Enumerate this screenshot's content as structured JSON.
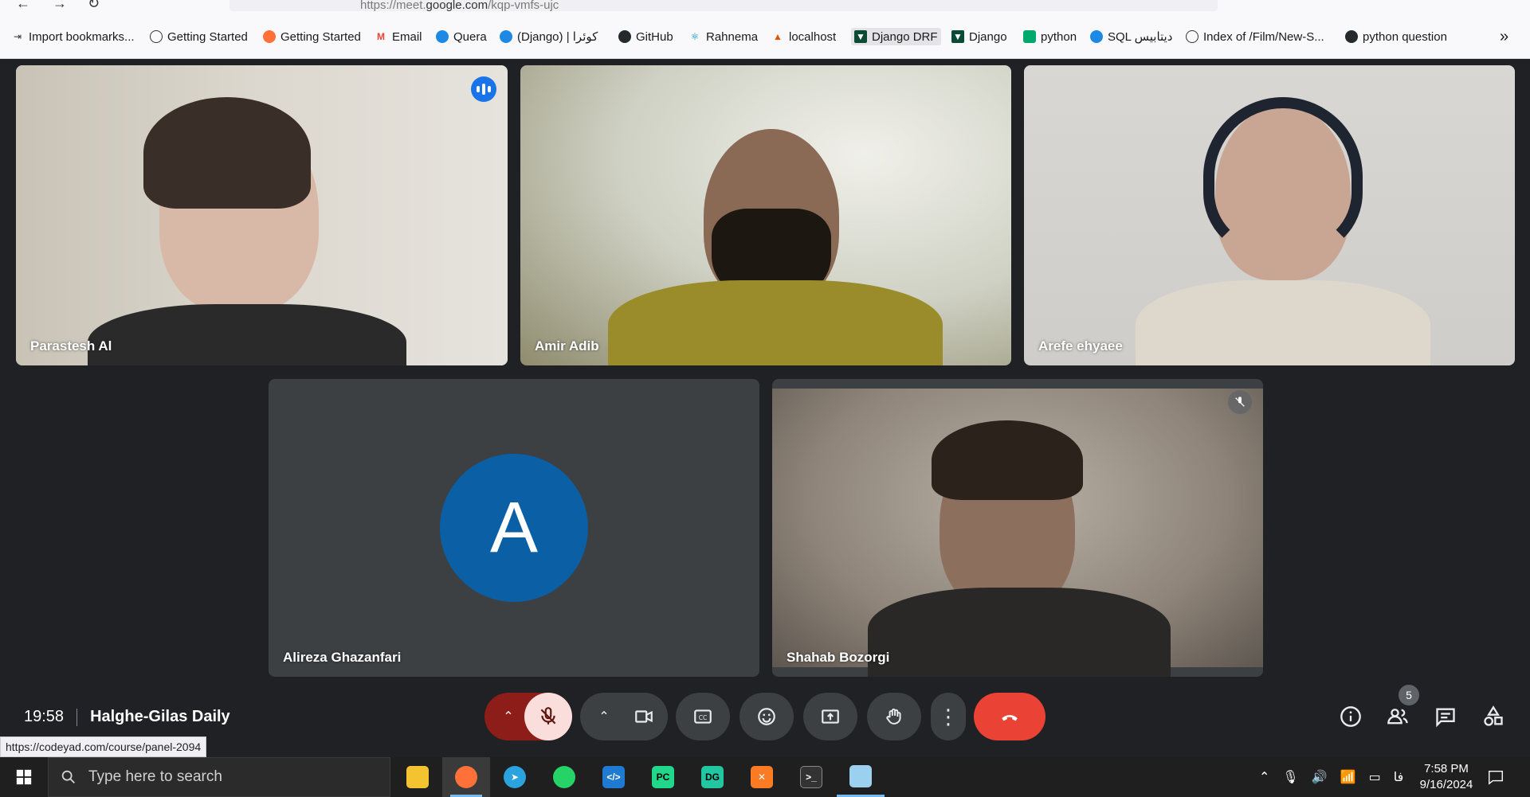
{
  "browser": {
    "url_prefix": "https://meet.",
    "url_domain": "google.com",
    "url_path": "/kqp-vmfs-ujc",
    "bookmarks": [
      {
        "label": "Import bookmarks..."
      },
      {
        "label": "Getting Started"
      },
      {
        "label": "Getting Started"
      },
      {
        "label": "Email"
      },
      {
        "label": "Quera"
      },
      {
        "label": "(Django) | کوئرا"
      },
      {
        "label": "GitHub"
      },
      {
        "label": "Rahnema"
      },
      {
        "label": "localhost"
      },
      {
        "label": "Django DRF"
      },
      {
        "label": "Django"
      },
      {
        "label": "python"
      },
      {
        "label": "SQL دیتابیس"
      },
      {
        "label": "Index of /Film/New-S..."
      },
      {
        "label": "python question"
      }
    ]
  },
  "participants": [
    {
      "name": "Parastesh Al",
      "speaking": true
    },
    {
      "name": "Amir Adib"
    },
    {
      "name": "Arefe ehyaee"
    },
    {
      "name": "Alireza Ghazanfari",
      "avatar_letter": "A"
    },
    {
      "name": "Shahab Bozorgi",
      "muted": true
    }
  ],
  "meeting": {
    "time": "19:58",
    "title": "Halghe-Gilas Daily",
    "participant_count": "5"
  },
  "status_bar": {
    "url": "https://codeyad.com/course/panel-2094"
  },
  "taskbar": {
    "search_placeholder": "Type here to search",
    "lang": "فا",
    "time": "7:58 PM",
    "date": "9/16/2024"
  },
  "colors": {
    "meet_background": "#202124",
    "tile_background": "#3c4043",
    "leave_button": "#ea4335",
    "mic_off_button": "#f9dedc",
    "mic_chevron_bg": "#8c1d18",
    "speaking_outline": "#8ab4f8",
    "avatar": "#0b5fa5"
  }
}
